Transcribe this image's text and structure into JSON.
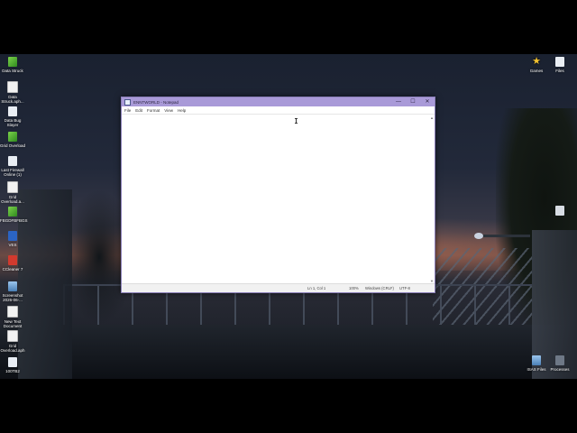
{
  "desktop_left_icons": [
    {
      "label": "Data Struck",
      "icon": "app-icon-green"
    },
    {
      "label": "Data Struck.aph...",
      "icon": "document-icon"
    },
    {
      "label": "Data Bug Slayer",
      "icon": "app-icon-round"
    },
    {
      "label": "Grid Overload",
      "icon": "app-icon-green"
    },
    {
      "label": "Last Firewall Online (1)",
      "icon": "app-icon-round"
    },
    {
      "label": "Grid Overload.a...",
      "icon": "document-icon"
    },
    {
      "label": "FBGDFBFBGS",
      "icon": "app-icon-green"
    },
    {
      "label": "VES",
      "icon": "word-icon"
    },
    {
      "label": "CCleaner 7",
      "icon": "ccleaner-icon"
    },
    {
      "label": "Screenshot 2026-06-...",
      "icon": "image-icon"
    },
    {
      "label": "New Text Document",
      "icon": "document-icon"
    },
    {
      "label": "Grid Overload.aph",
      "icon": "document-icon"
    },
    {
      "label": "100TB2",
      "icon": "app-icon-round"
    }
  ],
  "desktop_right_icons": [
    {
      "label": "Games",
      "icon": "star-icon"
    },
    {
      "label": "Files",
      "icon": "app-icon-round"
    },
    {
      "label": "",
      "icon": "recycle-bin-icon"
    },
    {
      "label": "ISAS Files",
      "icon": "image-icon"
    },
    {
      "label": "Processes",
      "icon": "processes-icon"
    }
  ],
  "notepad": {
    "title": "ENNTWORLD - Notepad",
    "menu": [
      "File",
      "Edit",
      "Format",
      "View",
      "Help"
    ],
    "content": "",
    "status": {
      "position": "Ln 1, Col 1",
      "zoom": "100%",
      "line_ending": "Windows (CRLF)",
      "encoding": "UTF-8"
    },
    "controls": {
      "minimize": "—",
      "maximize": "☐",
      "close": "✕"
    }
  }
}
